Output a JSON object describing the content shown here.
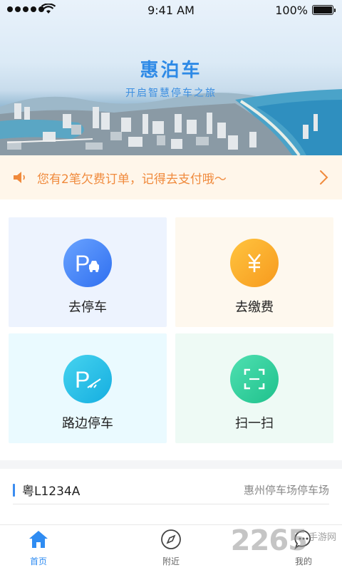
{
  "status_bar": {
    "time": "9:41 AM",
    "battery": "100%"
  },
  "hero": {
    "title": "惠泊车",
    "subtitle": "开启智慧停车之旅"
  },
  "notice": {
    "text": "您有2笔欠费订单，记得去支付哦～",
    "icon": "speaker-icon",
    "accent": "#f08a3c"
  },
  "actions": [
    {
      "label": "去停车",
      "icon": "parking-car-icon",
      "color": "#3f7ef5"
    },
    {
      "label": "去缴费",
      "icon": "yuan-icon",
      "color": "#f9a825"
    },
    {
      "label": "路边停车",
      "icon": "roadside-parking-icon",
      "color": "#20b6e6"
    },
    {
      "label": "扫一扫",
      "icon": "scan-icon",
      "color": "#26c896"
    }
  ],
  "plate": {
    "number": "粤L1234A",
    "lot": "惠州停车场停车场"
  },
  "tabbar": {
    "items": [
      {
        "label": "首页",
        "icon": "home-icon",
        "active": true
      },
      {
        "label": "附近",
        "icon": "compass-icon",
        "active": false
      },
      {
        "label": "我的",
        "icon": "chat-user-icon",
        "active": false
      }
    ]
  },
  "watermark": {
    "number": "2265",
    "site": "手游网"
  }
}
